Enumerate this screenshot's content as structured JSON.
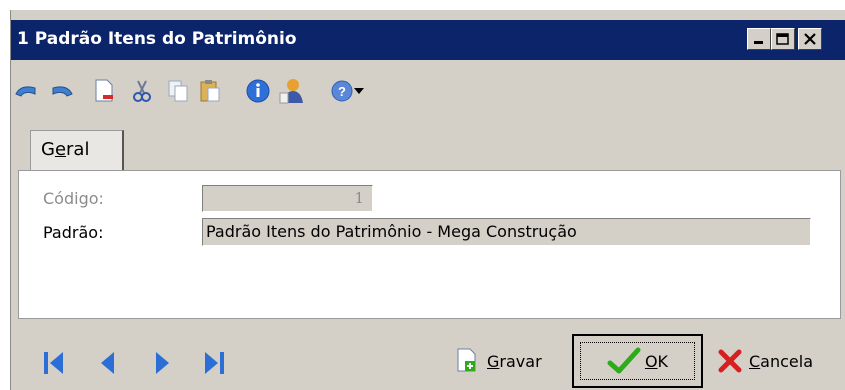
{
  "window": {
    "title": "1 Padrão Itens do Patrimônio",
    "controls": [
      "minimize",
      "maximize",
      "close"
    ]
  },
  "toolbar": {
    "icons": [
      "undo-icon",
      "redo-icon",
      "new-document-icon",
      "cut-icon",
      "copy-icon",
      "paste-icon",
      "info-icon",
      "user-icon",
      "help-icon",
      "dropdown-arrow-icon"
    ]
  },
  "tabs": [
    {
      "label_pre": "G",
      "label_u": "e",
      "label_post": "ral"
    }
  ],
  "form": {
    "codigo_label": "Código:",
    "codigo_value": "1",
    "padrao_label": "Padrão:",
    "padrao_value": "Padrão Itens do Patrimônio - Mega Construção"
  },
  "actions": {
    "gravar_u": "G",
    "gravar_rest": "ravar",
    "ok_u": "O",
    "ok_rest": "K",
    "cancela_u": "C",
    "cancela_rest": "ancela"
  },
  "nav": [
    "first-record",
    "previous-record",
    "next-record",
    "last-record"
  ],
  "colors": {
    "titlebar": "#0b246a",
    "face": "#d4d0c8",
    "nav_blue": "#2b6fd6",
    "ok_green": "#2eaa1a",
    "cancel_red": "#d42020"
  }
}
